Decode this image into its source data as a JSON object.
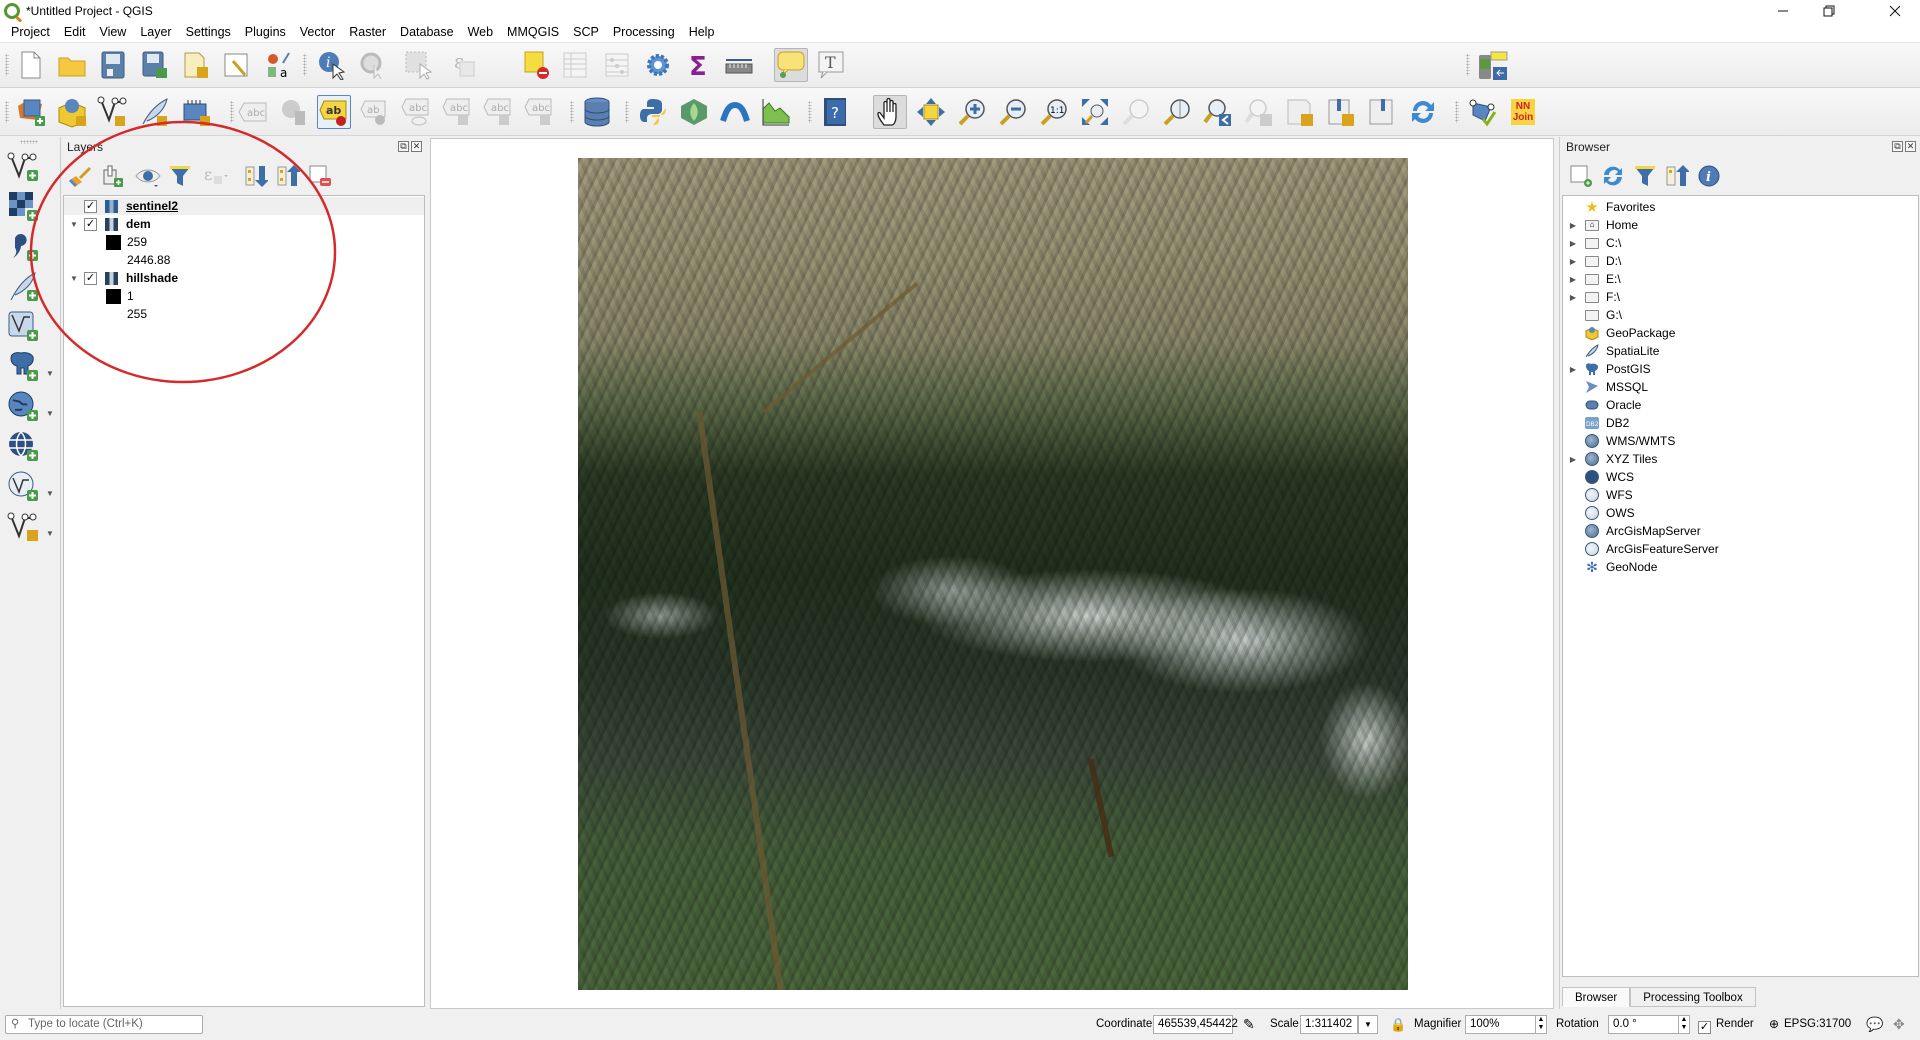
{
  "window": {
    "title": "*Untitled Project - QGIS",
    "controls": [
      "minimize",
      "restore",
      "close"
    ]
  },
  "menu": [
    "Project",
    "Edit",
    "View",
    "Layer",
    "Settings",
    "Plugins",
    "Vector",
    "Raster",
    "Database",
    "Web",
    "MMQGIS",
    "SCP",
    "Processing",
    "Help"
  ],
  "toolbar1": {
    "buttons": [
      "new-project",
      "open-project",
      "save-project",
      "save-project-as",
      "new-print-layout",
      "layout-manager",
      "style-manager",
      "identify-features",
      "run-feature-action",
      "select-features",
      "select-by-expression",
      "deselect-all",
      "open-attribute-table",
      "statistical-summary",
      "processing-toolbox",
      "field-calculator",
      "measure-line",
      "show-map-tips",
      "text-annotation"
    ],
    "right_buttons": [
      "gps-tool"
    ]
  },
  "toolbar2": {
    "buttons": [
      "data-source-manager",
      "new-geopackage-layer",
      "new-shapefile-layer",
      "new-spatialite-layer",
      "new-virtual-layer",
      "layer-labeling",
      "layer-diagram",
      "highlight-pinned-labels",
      "pin-labels",
      "show-hide-labels",
      "move-label",
      "rotate-label",
      "change-label",
      "db-manager",
      "python-console",
      "scp-plugin",
      "network-plugin",
      "profile-tool",
      "help-contents",
      "pan-map",
      "pan-to-selection",
      "zoom-in",
      "zoom-out",
      "zoom-native",
      "zoom-full",
      "zoom-to-selection",
      "zoom-to-layer",
      "zoom-last",
      "zoom-next",
      "new-map-view",
      "new-3d-map-view",
      "new-bookmark",
      "show-bookmarks",
      "refresh",
      "digitizing-tool"
    ],
    "nn_join_label": "NN\nJoin"
  },
  "left_tools": [
    "add-vector-layer",
    "add-raster-layer",
    "add-delimited-text-layer",
    "add-spatialite-layer",
    "add-virtual-layer",
    "add-postgis-layer",
    "add-wms-layer",
    "add-wcs-layer",
    "add-wfs-layer",
    "new-temporary-scratch-layer"
  ],
  "layers_panel": {
    "title": "Layers",
    "toolbar": [
      "open-layer-styling",
      "add-group",
      "manage-visibility",
      "filter-legend",
      "filter-by-expression",
      "expand-all",
      "collapse-all",
      "remove-layer"
    ],
    "layers": [
      {
        "name": "sentinel2",
        "checked": true,
        "selected": true,
        "expanded": false,
        "legend": []
      },
      {
        "name": "dem",
        "checked": true,
        "selected": false,
        "expanded": true,
        "legend": [
          {
            "swatch": "#000000",
            "label": "259"
          },
          {
            "swatch": null,
            "label": "2446.88"
          }
        ]
      },
      {
        "name": "hillshade",
        "checked": true,
        "selected": false,
        "expanded": true,
        "legend": [
          {
            "swatch": "#000000",
            "label": "1"
          },
          {
            "swatch": null,
            "label": "255"
          }
        ]
      }
    ],
    "annotation_color": "#d42a2a"
  },
  "browser_panel": {
    "title": "Browser",
    "toolbar": [
      "add-selected-layers",
      "refresh",
      "filter-browser",
      "collapse-all",
      "enable-properties"
    ],
    "items": [
      {
        "label": "Favorites",
        "icon": "star-icon",
        "expandable": false
      },
      {
        "label": "Home",
        "icon": "home-folder-icon",
        "expandable": true
      },
      {
        "label": "C:\\",
        "icon": "folder-icon",
        "expandable": true
      },
      {
        "label": "D:\\",
        "icon": "folder-icon",
        "expandable": true
      },
      {
        "label": "E:\\",
        "icon": "folder-icon",
        "expandable": true
      },
      {
        "label": "F:\\",
        "icon": "folder-icon",
        "expandable": true
      },
      {
        "label": "G:\\",
        "icon": "folder-icon",
        "expandable": false
      },
      {
        "label": "GeoPackage",
        "icon": "geopackage-icon",
        "expandable": false
      },
      {
        "label": "SpatiaLite",
        "icon": "spatialite-icon",
        "expandable": false
      },
      {
        "label": "PostGIS",
        "icon": "postgis-icon",
        "expandable": true
      },
      {
        "label": "MSSQL",
        "icon": "mssql-icon",
        "expandable": false
      },
      {
        "label": "Oracle",
        "icon": "oracle-icon",
        "expandable": false
      },
      {
        "label": "DB2",
        "icon": "db2-icon",
        "expandable": false
      },
      {
        "label": "WMS/WMTS",
        "icon": "wms-icon",
        "expandable": false
      },
      {
        "label": "XYZ Tiles",
        "icon": "xyz-icon",
        "expandable": true
      },
      {
        "label": "WCS",
        "icon": "wcs-icon",
        "expandable": false
      },
      {
        "label": "WFS",
        "icon": "wfs-icon",
        "expandable": false
      },
      {
        "label": "OWS",
        "icon": "ows-icon",
        "expandable": false
      },
      {
        "label": "ArcGisMapServer",
        "icon": "arcgis-mapserver-icon",
        "expandable": false
      },
      {
        "label": "ArcGisFeatureServer",
        "icon": "arcgis-featureserver-icon",
        "expandable": false
      },
      {
        "label": "GeoNode",
        "icon": "geonode-icon",
        "expandable": false
      }
    ],
    "tabs": [
      {
        "label": "Browser",
        "selected": true
      },
      {
        "label": "Processing Toolbox",
        "selected": false
      }
    ]
  },
  "map_canvas": {
    "layer_shown": "sentinel2",
    "description": "Sentinel-2 true color satellite image of mountainous terrain with snow-capped ridges"
  },
  "statusbar": {
    "locator_placeholder": "Type to locate (Ctrl+K)",
    "coordinate_label": "Coordinate",
    "coordinate_value": "465539,454422",
    "scale_label": "Scale",
    "scale_value": "1:311402",
    "magnifier_label": "Magnifier",
    "magnifier_value": "100%",
    "rotation_label": "Rotation",
    "rotation_value": "0.0 °",
    "render_label": "Render",
    "render_checked": true,
    "crs_label": "EPSG:31700"
  }
}
